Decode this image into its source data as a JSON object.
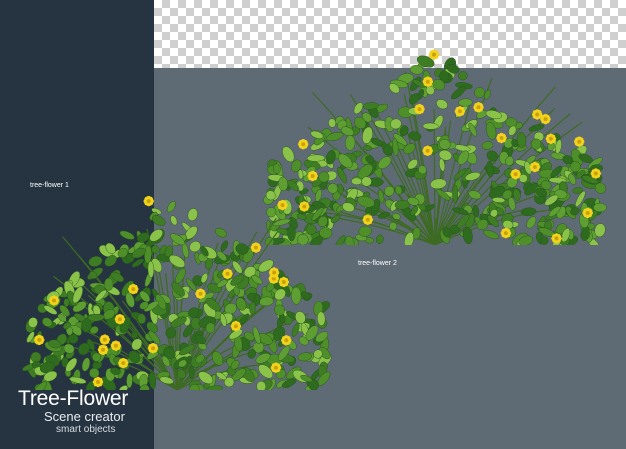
{
  "labels": {
    "plant_1": "tree-flower 1",
    "plant_2": "tree-flower 2"
  },
  "branding": {
    "title": "Tree-Flower",
    "subtitle": "Scene creator",
    "tagline": "smart objects"
  },
  "colors": {
    "dark_panel": "#263442",
    "gray_panel": "#5f6b74",
    "leaf_dark": "#2f6b1e",
    "leaf_mid": "#4f8f2a",
    "leaf_light": "#8bc34a",
    "flower": "#f2d21b"
  }
}
